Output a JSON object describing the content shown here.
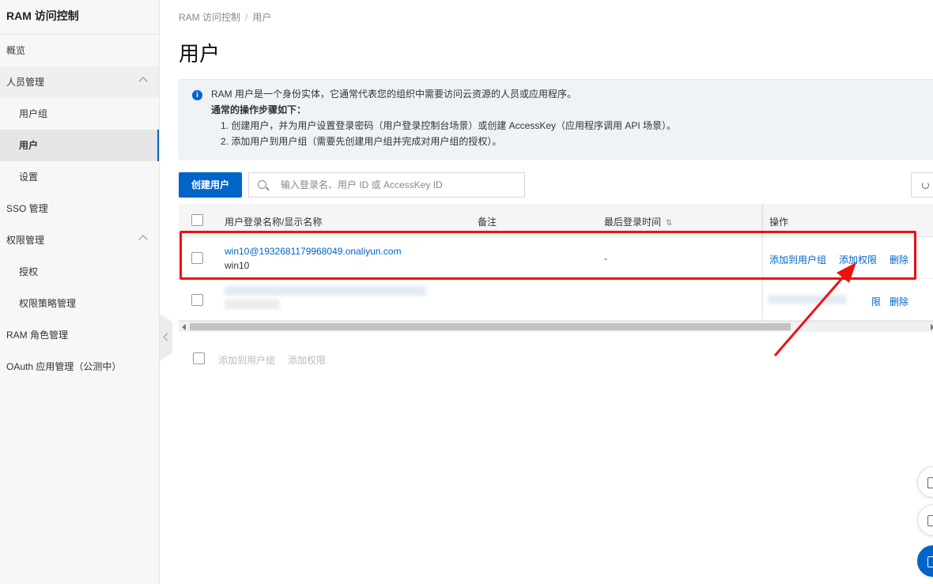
{
  "sidebar": {
    "title": "RAM 访问控制",
    "items": [
      {
        "label": "概览"
      },
      {
        "label": "人员管理"
      },
      {
        "label": "用户组"
      },
      {
        "label": "用户"
      },
      {
        "label": "设置"
      },
      {
        "label": "SSO 管理"
      },
      {
        "label": "权限管理"
      },
      {
        "label": "授权"
      },
      {
        "label": "权限策略管理"
      },
      {
        "label": "RAM 角色管理"
      },
      {
        "label": "OAuth 应用管理（公测中）"
      }
    ]
  },
  "breadcrumb": {
    "root": "RAM 访问控制",
    "sep": "/",
    "current": "用户"
  },
  "page_title": "用户",
  "info": {
    "line1": "RAM 用户是一个身份实体，它通常代表您的组织中需要访问云资源的人员或应用程序。",
    "line2": "通常的操作步骤如下：",
    "step1": "1. 创建用户，并为用户设置登录密码（用户登录控制台场景）或创建 AccessKey（应用程序调用 API 场景）。",
    "step2": "2. 添加用户到用户组（需要先创建用户组并完成对用户组的授权）。"
  },
  "toolbar": {
    "create_label": "创建用户",
    "search_placeholder": "输入登录名、用户 ID 或 AccessKey ID"
  },
  "table": {
    "headers": {
      "name": "用户登录名称/显示名称",
      "note": "备注",
      "last_login": "最后登录时间",
      "ops": "操作"
    },
    "rows": [
      {
        "login": "win10@1932681179968049.onaliyun.com",
        "display": "win10",
        "last_login": "-",
        "op_add_group": "添加到用户组",
        "op_add_perm": "添加权限",
        "op_delete": "删除"
      },
      {
        "op_partial": "限",
        "op_delete": "删除"
      }
    ]
  },
  "batch": {
    "add_group": "添加到用户组",
    "add_perm": "添加权限"
  },
  "colors": {
    "primary": "#0064c8",
    "highlight": "#f01010"
  }
}
